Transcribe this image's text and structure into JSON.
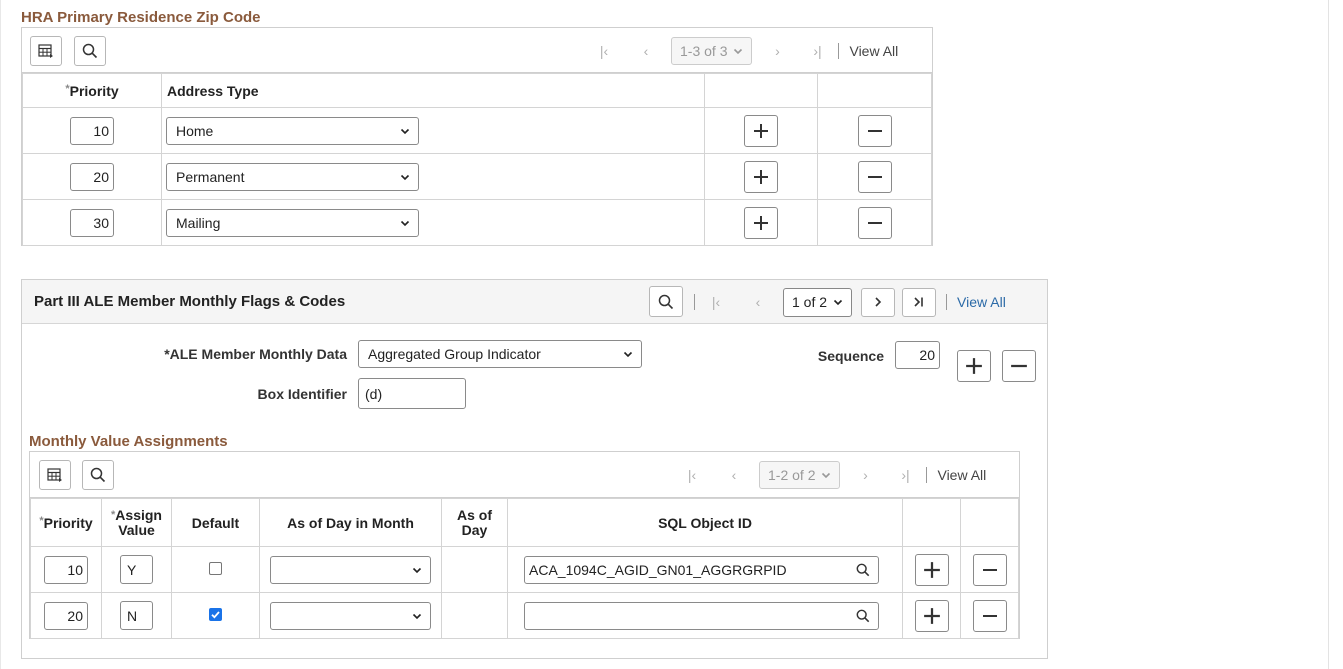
{
  "hra": {
    "title": "HRA Primary Residence Zip Code",
    "pager_text": "1-3 of 3",
    "view_all": "View All",
    "col_priority": "Priority",
    "col_address_type": "Address Type",
    "rows": [
      {
        "priority": "10",
        "address_type": "Home"
      },
      {
        "priority": "20",
        "address_type": "Permanent"
      },
      {
        "priority": "30",
        "address_type": "Mailing"
      }
    ]
  },
  "ale": {
    "title": "Part III ALE Member Monthly Flags & Codes",
    "pager_text": "1 of 2",
    "view_all": "View All",
    "member_data_label": "*ALE Member Monthly Data",
    "member_data_value": "Aggregated Group Indicator",
    "sequence_label": "Sequence",
    "sequence_value": "20",
    "box_identifier_label": "Box Identifier",
    "box_identifier_value": "(d)"
  },
  "mva": {
    "title": "Monthly Value Assignments",
    "pager_text": "1-2 of 2",
    "view_all": "View All",
    "col_priority": "Priority",
    "col_assign_value_1": "Assign",
    "col_assign_value_2": "Value",
    "col_default": "Default",
    "col_as_of_day_in_month": "As of Day in Month",
    "col_as_of_day_1": "As of",
    "col_as_of_day_2": "Day",
    "col_sql_object_id": "SQL Object ID",
    "rows": [
      {
        "priority": "10",
        "assign_value": "Y",
        "default": false,
        "as_of_day_in_month": "",
        "sql_object_id": "ACA_1094C_AGID_GN01_AGGRGRPID"
      },
      {
        "priority": "20",
        "assign_value": "N",
        "default": true,
        "as_of_day_in_month": "",
        "sql_object_id": ""
      }
    ]
  },
  "colors": {
    "section_title": "#8a5a3c",
    "link": "#2b6aa7",
    "checkbox": "#1a73e8"
  }
}
